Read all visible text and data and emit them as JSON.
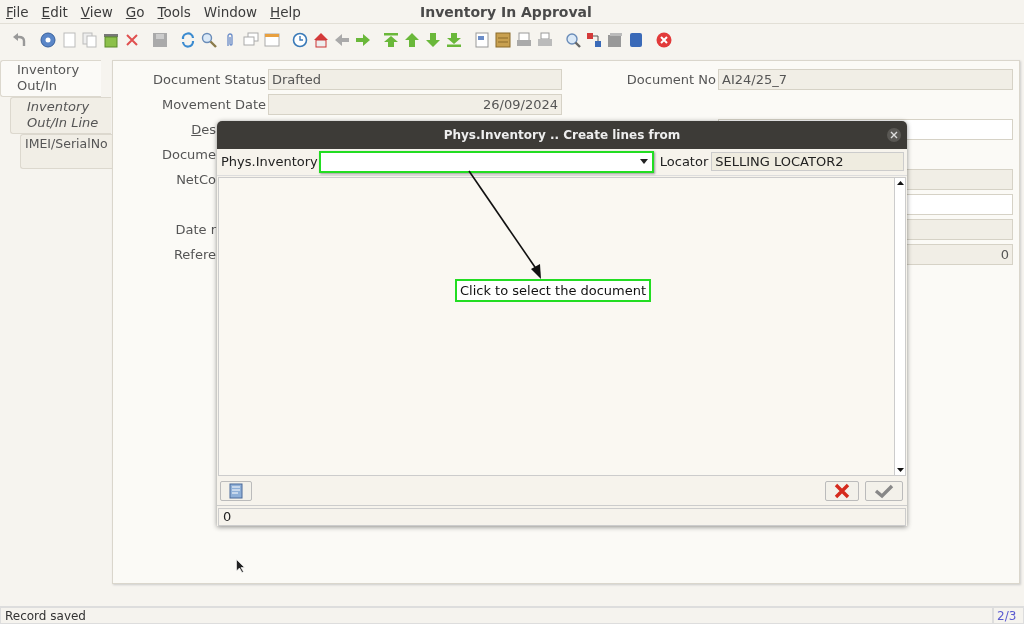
{
  "window": {
    "title": "Inventory In Approval"
  },
  "menu": [
    {
      "label": "File",
      "mnemonic": true
    },
    {
      "label": "Edit",
      "mnemonic": true
    },
    {
      "label": "View",
      "mnemonic": true
    },
    {
      "label": "Go",
      "mnemonic": true
    },
    {
      "label": "Tools",
      "mnemonic": true
    },
    {
      "label": "Window",
      "mnemonic": false
    },
    {
      "label": "Help",
      "mnemonic": true
    }
  ],
  "tabs": [
    {
      "label": "Inventory Out/In",
      "selected": true,
      "emphasized": false,
      "children": [
        {
          "label": "Inventory Out/In Line",
          "selected": false,
          "emphasized": true,
          "children": [
            {
              "label": "IMEI/SerialNo",
              "selected": false,
              "emphasized": false
            }
          ]
        }
      ]
    }
  ],
  "form": {
    "rows": [
      {
        "left": {
          "label": "Document Status",
          "cut": false,
          "mnemonic": false,
          "value": "Drafted",
          "kind": "text",
          "readonly": true
        },
        "right": {
          "label": "Document No",
          "value": "AI24/25_7",
          "kind": "text",
          "readonly": true
        }
      },
      {
        "left": {
          "label": "Movement Date",
          "cut": false,
          "mnemonic": false,
          "value": "26/09/2024",
          "kind": "date",
          "readonly": true
        }
      },
      {
        "left": {
          "label": "Des",
          "cut": true,
          "mnemonic": true
        },
        "right": {
          "kind": "text",
          "readonly": false
        }
      },
      {
        "left": {
          "label": "Docume",
          "cut": true,
          "mnemonic": false
        }
      },
      {
        "left": {
          "label": "NetCo",
          "cut": true,
          "mnemonic": false
        },
        "right": {
          "kind": "text",
          "readonly": true
        }
      },
      {
        "right": {
          "kind": "text",
          "readonly": false
        }
      },
      {
        "left": {
          "label": "Date r",
          "cut": true,
          "mnemonic": false
        },
        "right": {
          "kind": "text",
          "readonly": true
        }
      },
      {
        "left": {
          "label": "Refere",
          "cut": true,
          "mnemonic": false
        },
        "right": {
          "kind": "number",
          "readonly": true,
          "value": "0"
        }
      }
    ]
  },
  "dialog": {
    "title": "Phys.Inventory .. Create lines from",
    "inventory_label": "Phys.Inventory",
    "locator_label": "Locator",
    "locator_value": "SELLING LOCATOR2",
    "status": "0"
  },
  "annotation": {
    "text": "Click to select the document"
  },
  "status_bar": {
    "message": "Record saved",
    "record": "2/3"
  }
}
